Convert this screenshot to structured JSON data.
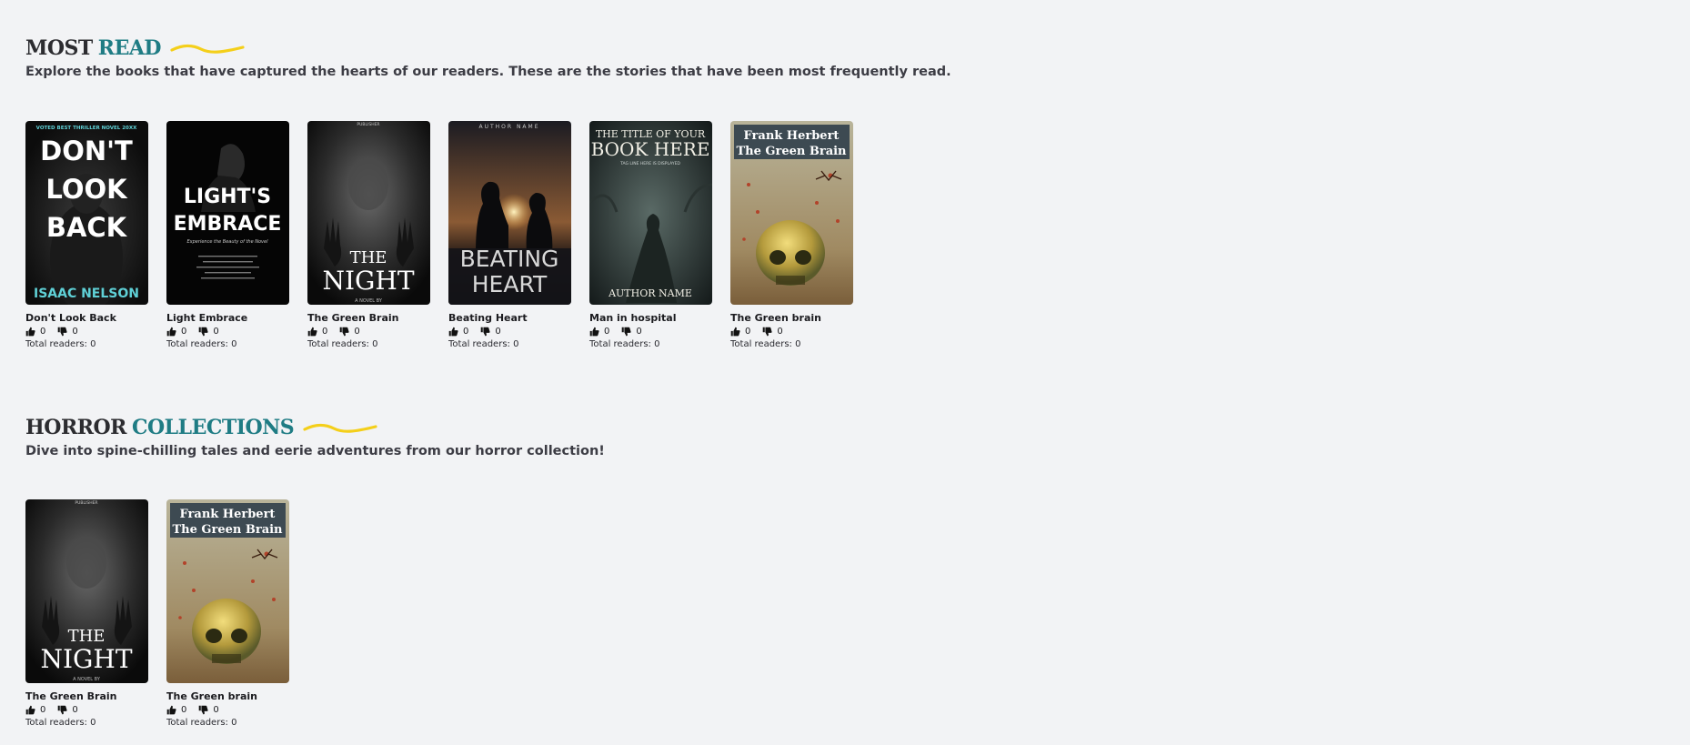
{
  "sections": [
    {
      "title_a": "MOST",
      "title_b": "READ",
      "subtitle": "Explore the books that have captured the hearts of our readers. These are the stories that have been most frequently read.",
      "books": [
        {
          "title": "Don't Look Back",
          "likes": "0",
          "dislikes": "0",
          "readers": "Total readers: 0",
          "cover": "dont-look-back",
          "cover_text": {
            "top": "VOTED BEST THRILLER NOVEL 20XX",
            "l1": "DON'T",
            "l2": "LOOK",
            "l3": "BACK",
            "author": "ISAAC NELSON"
          }
        },
        {
          "title": "Light Embrace",
          "likes": "0",
          "dislikes": "0",
          "readers": "Total readers: 0",
          "cover": "lights-embrace",
          "cover_text": {
            "l1": "LIGHT'S",
            "l2": "EMBRACE",
            "tag": "Experience the Beauty of the Novel"
          }
        },
        {
          "title": "The Green Brain",
          "likes": "0",
          "dislikes": "0",
          "readers": "Total readers: 0",
          "cover": "the-night",
          "cover_text": {
            "top": "PUBLISHER",
            "l1": "THE",
            "l2": "NIGHT",
            "author": "A NOVEL BY"
          }
        },
        {
          "title": "Beating Heart",
          "likes": "0",
          "dislikes": "0",
          "readers": "Total readers: 0",
          "cover": "beating-heart",
          "cover_text": {
            "top": "AUTHOR NAME",
            "l1": "BEATING",
            "l2": "HEART"
          }
        },
        {
          "title": "Man in hospital",
          "likes": "0",
          "dislikes": "0",
          "readers": "Total readers: 0",
          "cover": "title-here",
          "cover_text": {
            "l1": "THE TITLE OF YOUR",
            "l2": "BOOK HERE",
            "tag": "TAG LINE HERE IS DISPLAYED",
            "author": "AUTHOR NAME"
          }
        },
        {
          "title": "The Green brain",
          "likes": "0",
          "dislikes": "0",
          "readers": "Total readers: 0",
          "cover": "green-brain",
          "cover_text": {
            "l1": "Frank Herbert",
            "l2": "The Green Brain"
          }
        }
      ]
    },
    {
      "title_a": "HORROR",
      "title_b": "COLLECTIONS",
      "subtitle": "Dive into spine-chilling tales and eerie adventures from our horror collection!",
      "books": [
        {
          "title": "The Green Brain",
          "likes": "0",
          "dislikes": "0",
          "readers": "Total readers: 0",
          "cover": "the-night",
          "cover_text": {
            "top": "PUBLISHER",
            "l1": "THE",
            "l2": "NIGHT",
            "author": "A NOVEL BY"
          }
        },
        {
          "title": "The Green brain",
          "likes": "0",
          "dislikes": "0",
          "readers": "Total readers: 0",
          "cover": "green-brain",
          "cover_text": {
            "l1": "Frank Herbert",
            "l2": "The Green Brain"
          }
        }
      ]
    }
  ],
  "colors": {
    "accent": "#1f7c84",
    "squiggle": "#f4cf1a",
    "background": "#f2f3f5"
  },
  "icons": {
    "like": "thumbs-up-icon",
    "dislike": "thumbs-down-icon"
  }
}
